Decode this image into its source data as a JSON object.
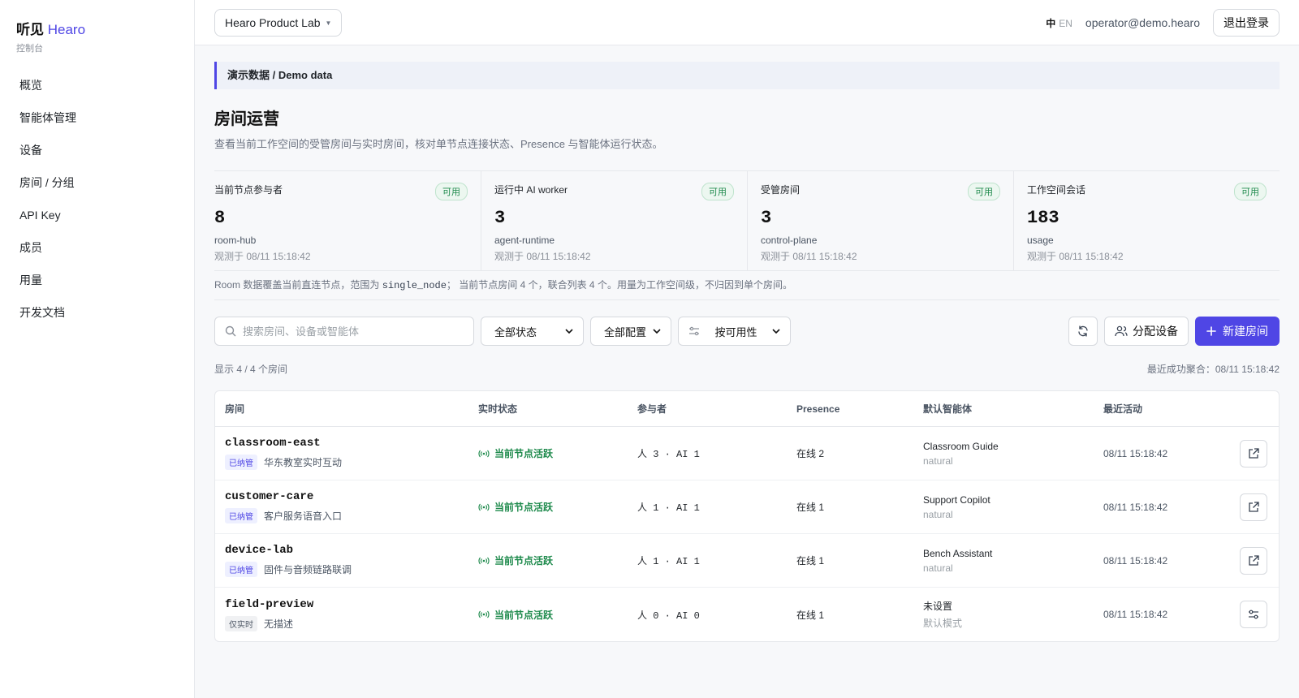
{
  "brand": {
    "name": "听见",
    "accent": "Hearo",
    "subtitle": "控制台"
  },
  "nav": [
    {
      "label": "概览"
    },
    {
      "label": "智能体管理"
    },
    {
      "label": "设备"
    },
    {
      "label": "房间 / 分组"
    },
    {
      "label": "API Key"
    },
    {
      "label": "成员"
    },
    {
      "label": "用量"
    },
    {
      "label": "开发文档"
    }
  ],
  "topbar": {
    "workspace": "Hearo Product Lab",
    "lang_zh": "中",
    "lang_en": "EN",
    "user_email": "operator@demo.hearo",
    "logout_label": "退出登录"
  },
  "banner": "演示数据 / Demo data",
  "page": {
    "title": "房间运营",
    "description": "查看当前工作空间的受管房间与实时房间，核对单节点连接状态、Presence 与智能体运行状态。"
  },
  "stats": [
    {
      "label": "当前节点参与者",
      "badge": "可用",
      "value": "8",
      "source": "room-hub",
      "observed": "观测于 08/11 15:18:42"
    },
    {
      "label": "运行中 AI worker",
      "badge": "可用",
      "value": "3",
      "source": "agent-runtime",
      "observed": "观测于 08/11 15:18:42"
    },
    {
      "label": "受管房间",
      "badge": "可用",
      "value": "3",
      "source": "control-plane",
      "observed": "观测于 08/11 15:18:42"
    },
    {
      "label": "工作空间会话",
      "badge": "可用",
      "value": "183",
      "source": "usage",
      "observed": "观测于 08/11 15:18:42"
    }
  ],
  "note": {
    "prefix": "Room 数据覆盖当前直连节点，范围为",
    "code": "single_node",
    "suffix": "； 当前节点房间 4 个，联合列表 4 个。用量为工作空间级，不归因到单个房间。"
  },
  "toolbar": {
    "search_placeholder": "搜索房间、设备或智能体",
    "status_filter": "全部状态",
    "config_filter": "全部配置",
    "sort": "按可用性",
    "assign_label": "分配设备",
    "new_room_label": "新建房间"
  },
  "meta": {
    "count": "显示 4 / 4 个房间",
    "last_aggregated": "最近成功聚合：08/11 15:18:42"
  },
  "table": {
    "headers": [
      "房间",
      "实时状态",
      "参与者",
      "Presence",
      "默认智能体",
      "最近活动"
    ],
    "rows": [
      {
        "name": "classroom-east",
        "tag": "已纳管",
        "desc": "华东教室实时互动",
        "status": "当前节点活跃",
        "participants": "人 3 · AI 1",
        "presence": "在线 2",
        "agent": "Classroom Guide",
        "mode": "natural",
        "activity": "08/11 15:18:42",
        "action": "open-external-icon"
      },
      {
        "name": "customer-care",
        "tag": "已纳管",
        "desc": "客户服务语音入口",
        "status": "当前节点活跃",
        "participants": "人 1 · AI 1",
        "presence": "在线 1",
        "agent": "Support Copilot",
        "mode": "natural",
        "activity": "08/11 15:18:42",
        "action": "open-external-icon"
      },
      {
        "name": "device-lab",
        "tag": "已纳管",
        "desc": "固件与音频链路联调",
        "status": "当前节点活跃",
        "participants": "人 1 · AI 1",
        "presence": "在线 1",
        "agent": "Bench Assistant",
        "mode": "natural",
        "activity": "08/11 15:18:42",
        "action": "open-external-icon"
      },
      {
        "name": "field-preview",
        "tag": "仅实时",
        "desc": "无描述",
        "status": "当前节点活跃",
        "participants": "人 0 · AI 0",
        "presence": "在线 1",
        "agent": "未设置",
        "mode": "默认模式",
        "activity": "08/11 15:18:42",
        "action": "configure-icon"
      }
    ]
  },
  "colors": {
    "accent": "#4f46e5",
    "ok": "#1e8a4c",
    "banner_bg": "#eef1f8"
  }
}
